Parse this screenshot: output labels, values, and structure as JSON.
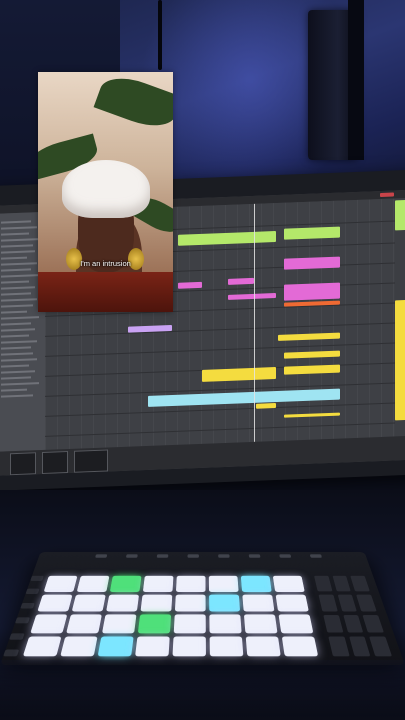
{
  "video_overlay": {
    "caption": "I'm an intrusion"
  },
  "daw": {
    "pad_colors": {
      "lit": "#eef0fb",
      "green": "#4fe07a",
      "cyan": "#7ce6ff"
    }
  }
}
